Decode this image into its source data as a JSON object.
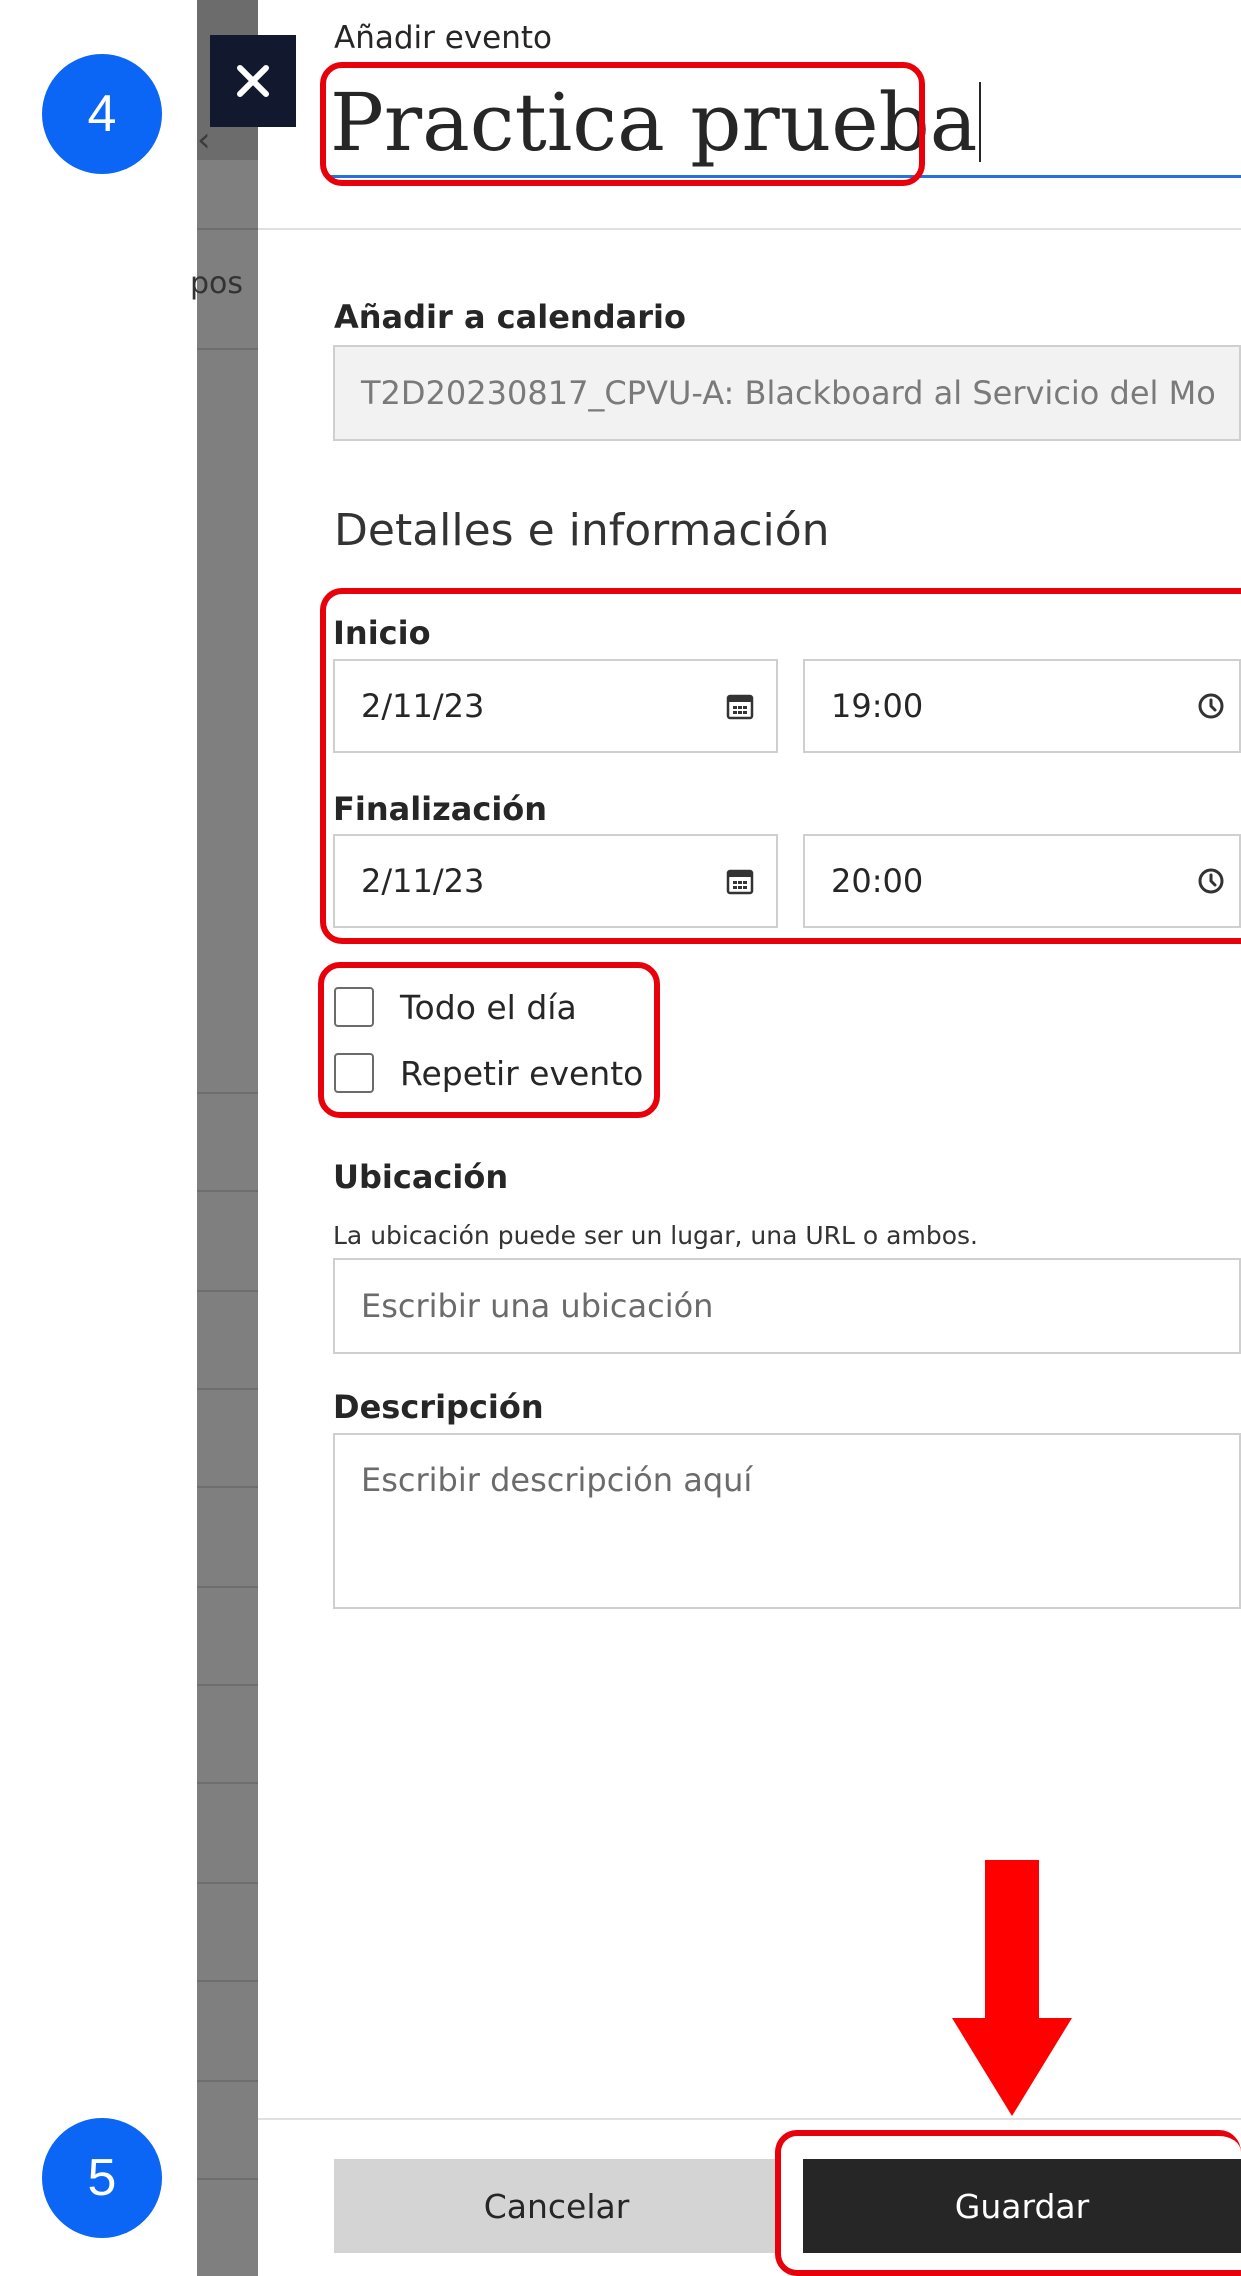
{
  "modal": {
    "overline": "Añadir evento",
    "title_value": "Practica prueba",
    "close_icon": "close-icon"
  },
  "background": {
    "partial_text": "pos"
  },
  "calendar": {
    "label": "Añadir a calendario",
    "value": "T2D20230817_CPVU-A: Blackboard al Servicio del Mo"
  },
  "details": {
    "section_title": "Detalles e información",
    "start": {
      "label": "Inicio",
      "date": "2/11/23",
      "time": "19:00",
      "date_icon": "calendar-icon",
      "time_icon": "clock-icon"
    },
    "end": {
      "label": "Finalización",
      "date": "2/11/23",
      "time": "20:00",
      "date_icon": "calendar-icon",
      "time_icon": "clock-icon"
    },
    "all_day": {
      "label": "Todo el día",
      "checked": false
    },
    "repeat": {
      "label": "Repetir evento",
      "checked": false
    }
  },
  "location": {
    "label": "Ubicación",
    "help": "La ubicación puede ser un lugar, una URL o ambos.",
    "placeholder": "Escribir una ubicación"
  },
  "description": {
    "label": "Descripción",
    "placeholder": "Escribir descripción aquí"
  },
  "footer": {
    "cancel_label": "Cancelar",
    "save_label": "Guardar"
  },
  "annotations": {
    "step_top": "4",
    "step_bottom": "5",
    "highlight_color": "#e8000b",
    "badge_color": "#0b66f5"
  }
}
